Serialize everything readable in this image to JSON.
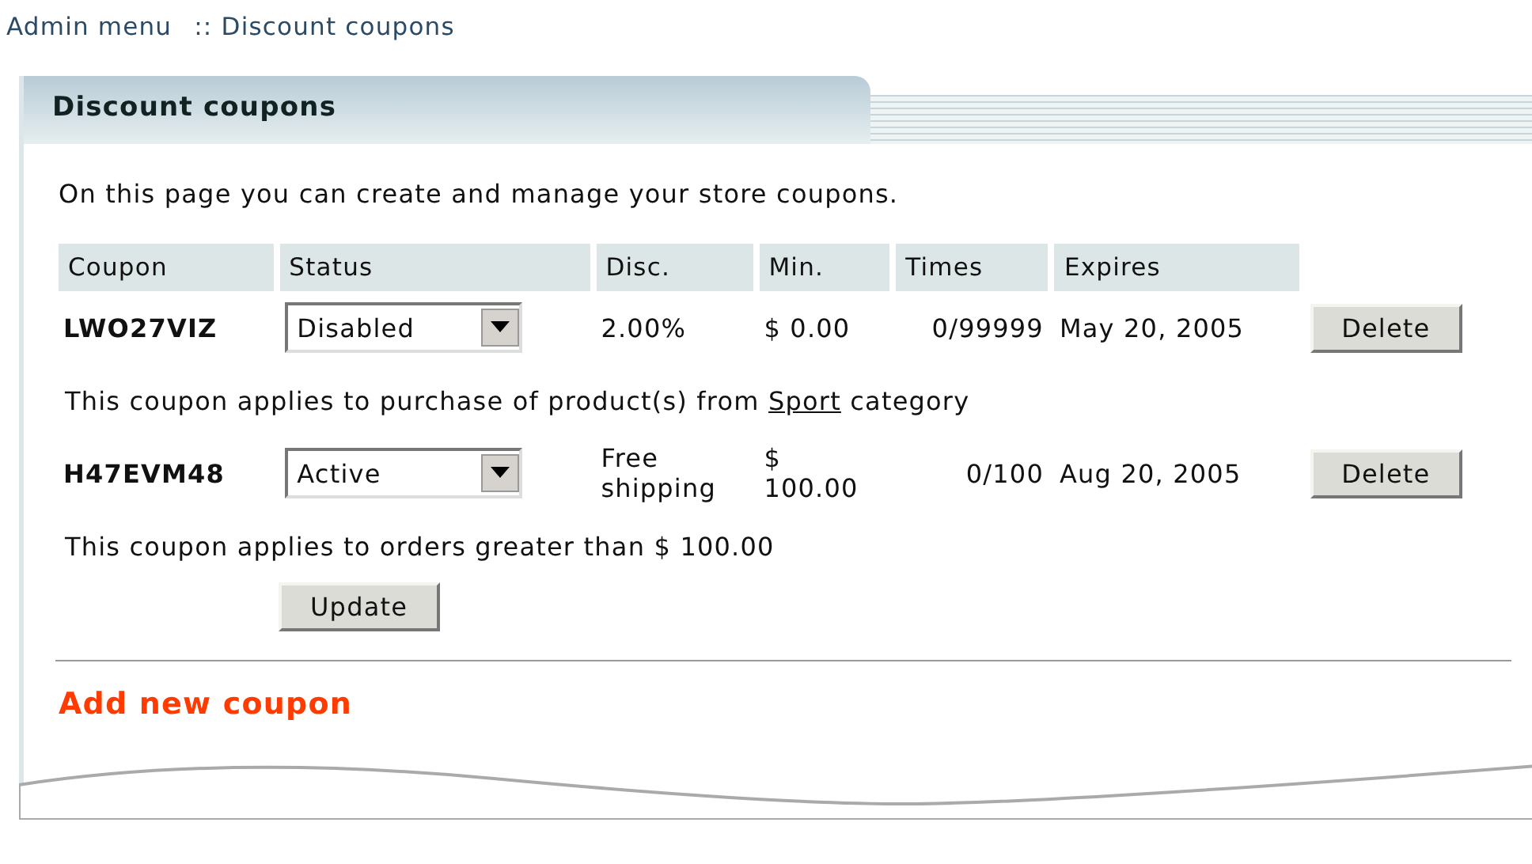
{
  "breadcrumb": {
    "link": "Admin menu",
    "separator": ":: Discount coupons"
  },
  "panel": {
    "title": "Discount coupons",
    "intro": "On this page you can create and manage your store coupons.",
    "columns": [
      "Coupon",
      "Status",
      "Disc.",
      "Min.",
      "Times",
      "Expires"
    ],
    "coupons": [
      {
        "code": "LWO27VIZ",
        "status": "Disabled",
        "discount": [
          "2.00%"
        ],
        "minimum": [
          "$ 0.00"
        ],
        "times": "0/99999",
        "expires": "May 20, 2005",
        "delete": "Delete",
        "note": {
          "before": "This coupon applies to purchase of product(s) from",
          "link": "Sport",
          "after": "category"
        }
      },
      {
        "code": "H47EVM48",
        "status": "Active",
        "discount": [
          "Free",
          "shipping"
        ],
        "minimum": [
          "$",
          "100.00"
        ],
        "times": "0/100",
        "expires": "Aug 20, 2005",
        "delete": "Delete",
        "note": {
          "before": "This coupon applies to orders greater than $ 100.00"
        }
      }
    ],
    "update": "Update",
    "add_link": "Add new coupon"
  }
}
